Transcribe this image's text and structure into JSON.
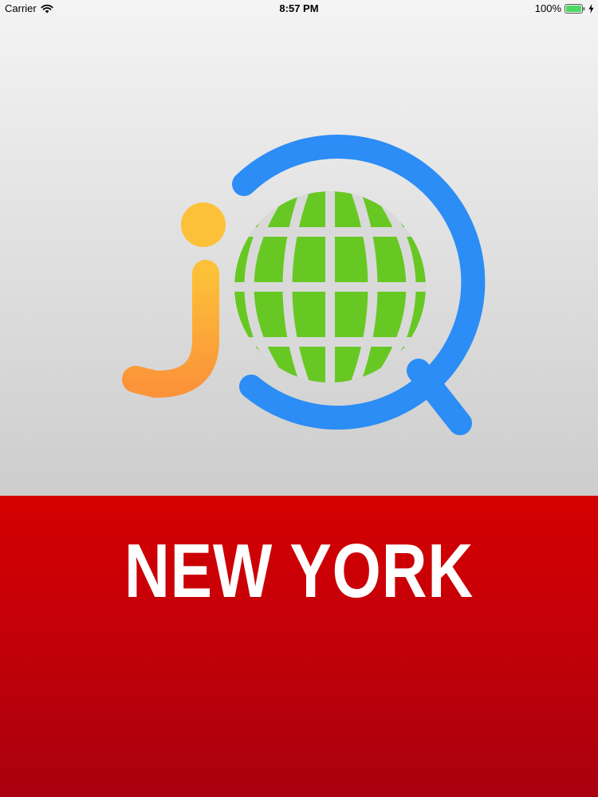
{
  "status_bar": {
    "carrier": "Carrier",
    "time": "8:57 PM",
    "battery_percent": "100%",
    "battery_level": 1.0,
    "wifi_icon": "wifi-icon",
    "battery_icon": "battery-icon",
    "charging_icon": "charging-bolt-icon"
  },
  "logo": {
    "icon": "globe-search-logo-icon",
    "colors": {
      "j_dot": "#fcc138",
      "j_stem": "#fb9439",
      "globe": "#67c823",
      "ring": "#2b8df5"
    }
  },
  "banner": {
    "city": "NEW YORK",
    "background": "#c60008",
    "text_color": "#ffffff"
  }
}
